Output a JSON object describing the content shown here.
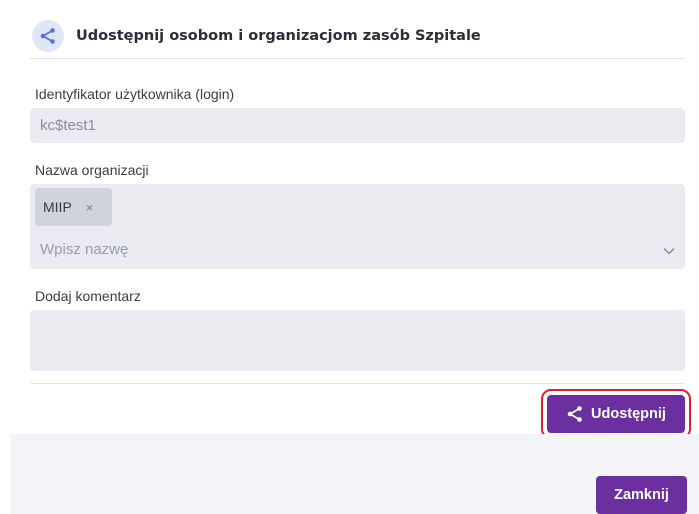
{
  "dialog": {
    "title": "Udostępnij osobom i organizacjom zasób Szpitale",
    "header_icon": "share-icon"
  },
  "login": {
    "label": "Identyfikator użytkownika (login)",
    "value": "kc$test1"
  },
  "organization": {
    "label": "Nazwa organizacji",
    "selected": [
      {
        "text": "MIIP",
        "remove_symbol": "×"
      }
    ],
    "placeholder": "Wpisz nazwę"
  },
  "comment": {
    "label": "Dodaj komentarz",
    "value": ""
  },
  "actions": {
    "share_label": "Udostępnij",
    "share_icon": "share-icon",
    "close_label": "Zamknij"
  },
  "colors": {
    "accent": "#6b2fa0",
    "highlight_border": "#e0202a",
    "field_bg": "#e9ebf1"
  }
}
